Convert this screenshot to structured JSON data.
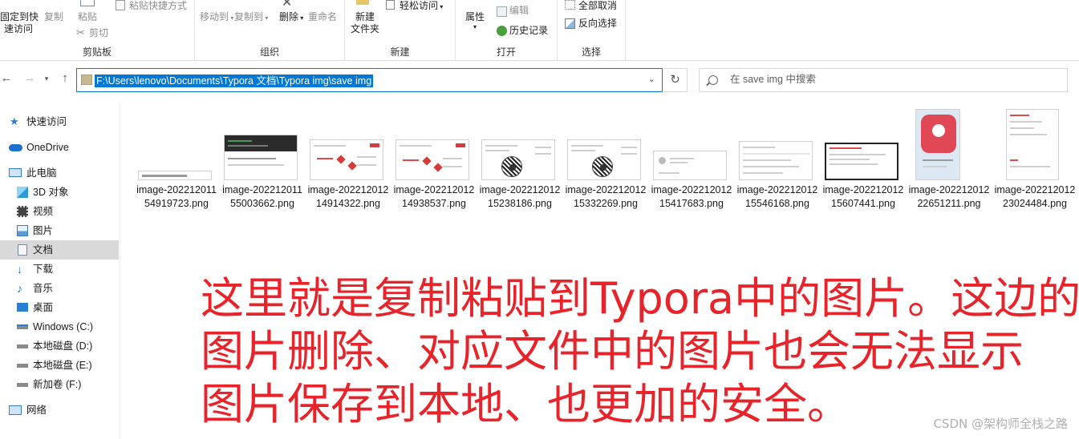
{
  "ribbon": {
    "clipboard": {
      "pin_line1": "固定到快",
      "pin_line2": "速访问",
      "copy": "复制",
      "paste": "粘贴",
      "paste_shortcut": "粘贴快捷方式",
      "cut": "剪切",
      "label": "剪贴板"
    },
    "organize": {
      "move_to": "移动到",
      "copy_to": "复制到",
      "delete": "删除",
      "rename": "重命名",
      "label": "组织"
    },
    "new": {
      "new_folder_line1": "新建",
      "new_folder_line2": "文件夹",
      "easy_access": "轻松访问",
      "label": "新建"
    },
    "open": {
      "properties": "属性",
      "edit": "编辑",
      "history": "历史记录",
      "label": "打开"
    },
    "select": {
      "select_all": "全部取消",
      "invert": "反向选择",
      "label": "选择"
    }
  },
  "nav": {
    "address": "F:\\Users\\lenovo\\Documents\\Typora 文档\\Typora img\\save img",
    "search_placeholder": "在 save img 中搜索"
  },
  "sidebar": {
    "items": [
      {
        "label": "快速访问",
        "icon": "star-icon"
      },
      {
        "label": "OneDrive",
        "icon": "cloud-icon"
      },
      {
        "label": "此电脑",
        "icon": "computer-icon"
      },
      {
        "label": "3D 对象",
        "icon": "cube-icon"
      },
      {
        "label": "视频",
        "icon": "film-icon"
      },
      {
        "label": "图片",
        "icon": "picture-icon"
      },
      {
        "label": "文档",
        "icon": "document-icon"
      },
      {
        "label": "下载",
        "icon": "download-icon"
      },
      {
        "label": "音乐",
        "icon": "music-icon"
      },
      {
        "label": "桌面",
        "icon": "desktop-icon"
      },
      {
        "label": "Windows (C:)",
        "icon": "drive-windows-icon"
      },
      {
        "label": "本地磁盘 (D:)",
        "icon": "drive-icon"
      },
      {
        "label": "本地磁盘 (E:)",
        "icon": "drive-icon"
      },
      {
        "label": "新加卷 (F:)",
        "icon": "drive-icon"
      },
      {
        "label": "网络",
        "icon": "network-icon"
      }
    ]
  },
  "files": [
    {
      "name": "image-20221201154919723.png"
    },
    {
      "name": "image-20221201155003662.png"
    },
    {
      "name": "image-20221201214914322.png"
    },
    {
      "name": "image-20221201214938537.png"
    },
    {
      "name": "image-20221201215238186.png"
    },
    {
      "name": "image-20221201215332269.png"
    },
    {
      "name": "image-20221201215417683.png"
    },
    {
      "name": "image-20221201215546168.png"
    },
    {
      "name": "image-20221201215607441.png"
    },
    {
      "name": "image-20221201222651211.png"
    },
    {
      "name": "image-20221201223024484.png"
    }
  ],
  "overlay": {
    "line1": "这里就是复制粘贴到Typora中的图片。这边的",
    "line2": "图片删除、对应文件中的图片也会无法显示",
    "line3": "图片保存到本地、也更加的安全。",
    "color": "#e8232a"
  },
  "watermark": "CSDN @架构师全栈之路"
}
